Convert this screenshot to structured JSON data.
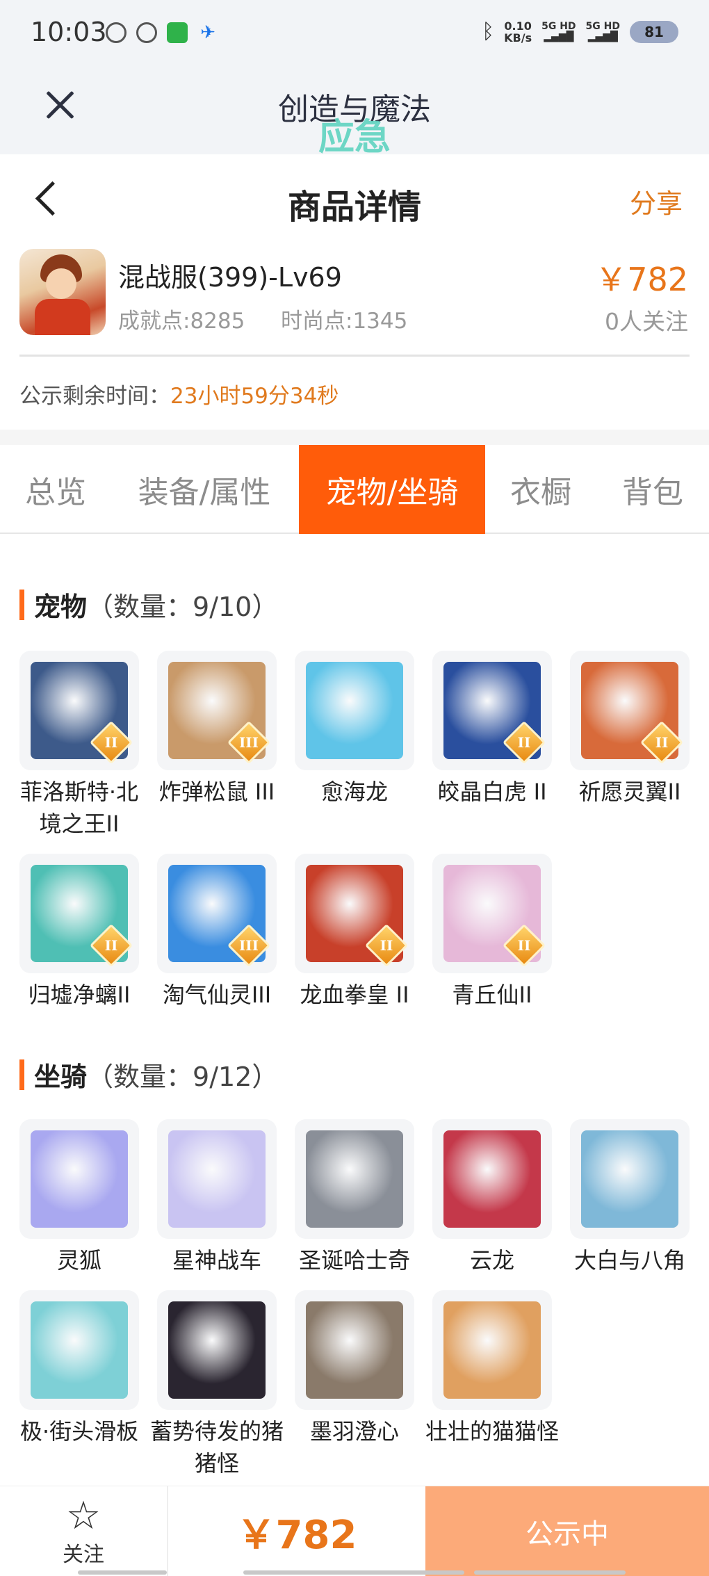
{
  "status_bar": {
    "time": "10:03",
    "net_speed": "0.10",
    "net_unit": "KB/s",
    "signal1": "5G HD",
    "signal2": "5G HD",
    "battery": "81"
  },
  "app_header": {
    "title": "创造与魔法",
    "subtitle": "应急"
  },
  "page_header": {
    "title": "商品详情",
    "share": "分享"
  },
  "product": {
    "name": "混战服(399)-Lv69",
    "achievement": "成就点:8285",
    "fashion": "时尚点:1345",
    "price": "￥782",
    "followers": "0人关注"
  },
  "countdown": {
    "label": "公示剩余时间：",
    "value": "23小时59分34秒"
  },
  "tabs": [
    {
      "label": "总览"
    },
    {
      "label": "装备/属性"
    },
    {
      "label": "宠物/坐骑"
    },
    {
      "label": "衣橱"
    },
    {
      "label": "背包"
    }
  ],
  "active_tab": 2,
  "pets": {
    "title": "宠物",
    "count": "（数量：9/10）",
    "items": [
      {
        "name": "菲洛斯特·北境之王II",
        "badge": "II",
        "color": "#3d5a8a"
      },
      {
        "name": "炸弹松鼠 III",
        "badge": "III",
        "color": "#c99a6a"
      },
      {
        "name": "愈海龙",
        "badge": "",
        "color": "#5fc4e8"
      },
      {
        "name": "皎晶白虎 II",
        "badge": "II",
        "color": "#2a4f9e"
      },
      {
        "name": "祈愿灵翼II",
        "badge": "II",
        "color": "#d86a3a"
      },
      {
        "name": "归墟净螭II",
        "badge": "II",
        "color": "#4fbfb4"
      },
      {
        "name": "淘气仙灵III",
        "badge": "III",
        "color": "#3a8de0"
      },
      {
        "name": "龙血拳皇 II",
        "badge": "II",
        "color": "#c8402a"
      },
      {
        "name": "青丘仙II",
        "badge": "II",
        "color": "#e6b8d8"
      }
    ]
  },
  "mounts": {
    "title": "坐骑",
    "count": "（数量：9/12）",
    "items": [
      {
        "name": "灵狐",
        "color": "#a9a8f0"
      },
      {
        "name": "星神战车",
        "color": "#c9c4f2"
      },
      {
        "name": "圣诞哈士奇",
        "color": "#8a8f98"
      },
      {
        "name": "云龙",
        "color": "#c4384a"
      },
      {
        "name": "大白与八角",
        "color": "#7fb8d8"
      },
      {
        "name": "极·街头滑板",
        "color": "#7ed0d6"
      },
      {
        "name": "蓄势待发的猪猪怪",
        "color": "#2a2530"
      },
      {
        "name": "墨羽澄心",
        "color": "#8a7a6a"
      },
      {
        "name": "壮壮的猫猫怪",
        "color": "#e0a060"
      }
    ]
  },
  "bottom_bar": {
    "follow": "关注",
    "price": "￥782",
    "status": "公示中"
  }
}
